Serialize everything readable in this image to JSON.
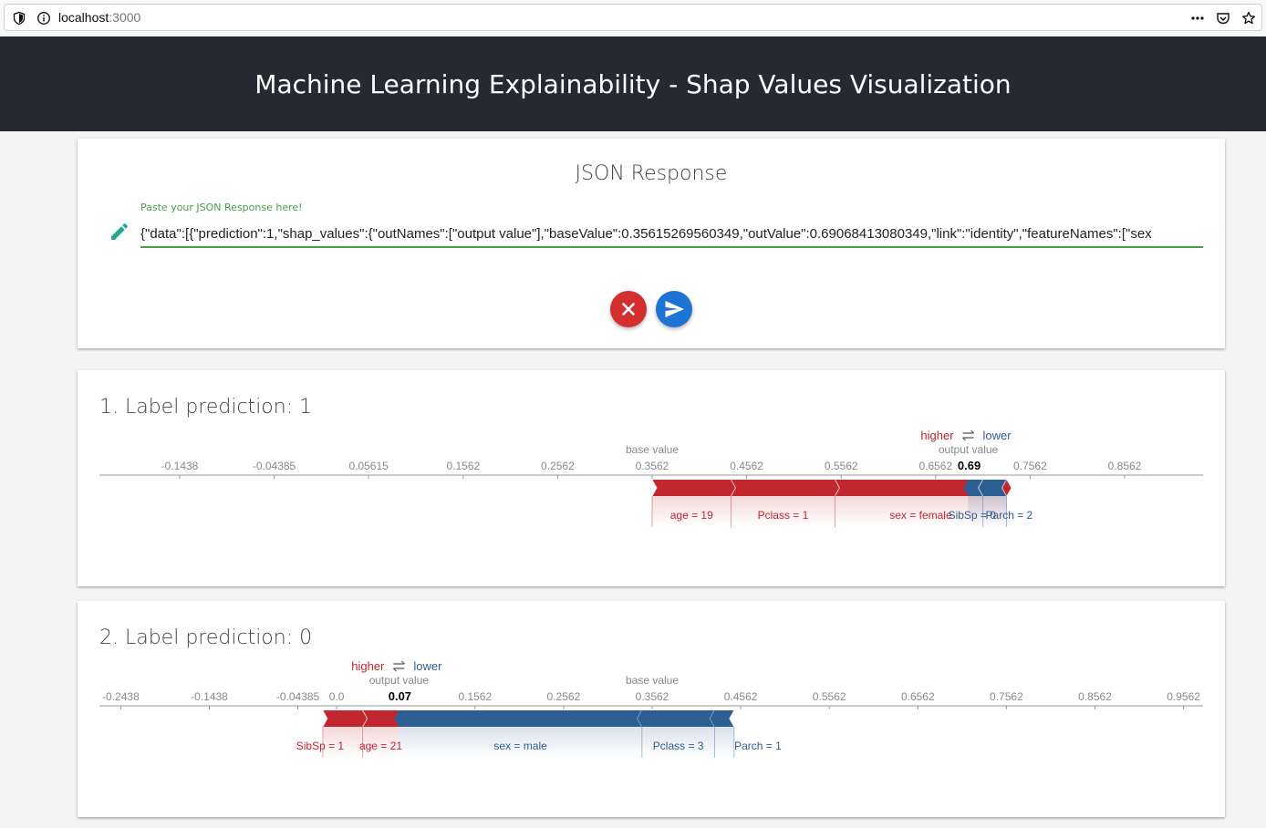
{
  "browser": {
    "url_host": "localhost",
    "url_port": ":3000"
  },
  "header": {
    "title": "Machine Learning Explainability - Shap Values Visualization"
  },
  "json_panel": {
    "title": "JSON Response",
    "input_label": "Paste your JSON Response here!",
    "input_value": "{\"data\":[{\"prediction\":1,\"shap_values\":{\"outNames\":[\"output value\"],\"baseValue\":0.35615269560349,\"outValue\":0.69068413080349,\"link\":\"identity\",\"featureNames\":[\"sex",
    "clear_icon": "close-icon",
    "send_icon": "send-icon"
  },
  "colors": {
    "positive": "#c2262e",
    "negative": "#2d5e91",
    "input_accent": "#43a047",
    "clear_button": "#d32f2f",
    "send_button": "#1e74d2"
  },
  "legend": {
    "higher": "higher",
    "lower": "lower",
    "output_value": "output value",
    "base_value": "base value"
  },
  "predictions": [
    {
      "title": "1. Label prediction: 1",
      "ticks": [
        "-0.1438",
        "-0.04385",
        "0.05615",
        "0.1562",
        "0.2562",
        "0.3562",
        "0.4562",
        "0.5562",
        "0.6562",
        "0.7562",
        "0.8562"
      ],
      "output_display": "0.69",
      "base_value": 0.3562,
      "output_value": 0.6907,
      "features": [
        {
          "label": "age = 19",
          "direction": "higher",
          "from": 0.3562,
          "to": 0.4397
        },
        {
          "label": "Pclass = 1",
          "direction": "higher",
          "from": 0.4397,
          "to": 0.5497
        },
        {
          "label": "sex = female",
          "direction": "higher",
          "from": 0.5497,
          "to": 0.7312
        },
        {
          "label": "SibSp = 0",
          "direction": "lower",
          "from": 0.7312,
          "to": 0.7062
        },
        {
          "label": "Parch = 2",
          "direction": "lower",
          "from": 0.7062,
          "to": 0.6907
        }
      ]
    },
    {
      "title": "2. Label prediction: 0",
      "ticks": [
        "-0.2438",
        "-0.1438",
        "-0.04385",
        "0.0",
        "0.1562",
        "0.2562",
        "0.3562",
        "0.4562",
        "0.5562",
        "0.6562",
        "0.7562",
        "0.8562",
        "0.9562"
      ],
      "output_display": "0.07",
      "base_value": 0.3562,
      "output_value": 0.0703,
      "features": [
        {
          "label": "SibSp = 1",
          "direction": "higher",
          "from": -0.0157,
          "to": 0.0293
        },
        {
          "label": "age = 21",
          "direction": "higher",
          "from": 0.0293,
          "to": 0.0703
        },
        {
          "label": "sex = male",
          "direction": "lower",
          "from": 0.0703,
          "to": 0.3447
        },
        {
          "label": "Pclass = 3",
          "direction": "lower",
          "from": 0.3447,
          "to": 0.4267
        },
        {
          "label": "Parch = 1",
          "direction": "lower",
          "from": 0.4267,
          "to": 0.4487
        }
      ]
    }
  ]
}
